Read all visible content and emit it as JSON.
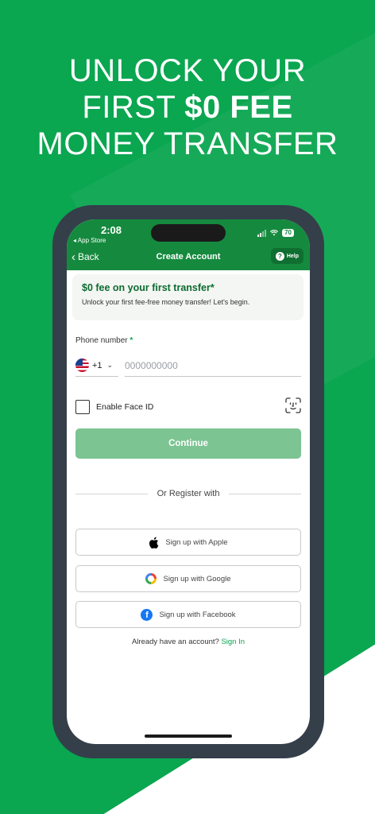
{
  "headline": {
    "line1": "UNLOCK YOUR",
    "line2_prefix": "FIRST ",
    "line2_bold": "$0 FEE",
    "line3": "MONEY TRANSFER"
  },
  "status_bar": {
    "time": "2:08",
    "back_app": "◂ App Store",
    "battery": "70"
  },
  "nav": {
    "back_label": "Back",
    "title": "Create Account",
    "help_label": "Help"
  },
  "promo": {
    "title": "$0 fee on your first transfer*",
    "subtitle": "Unlock your first fee-free money transfer! Let's begin."
  },
  "phone_field": {
    "label": "Phone number",
    "required_mark": "*",
    "country_code": "+1",
    "placeholder": "0000000000",
    "value": ""
  },
  "face_id": {
    "label": "Enable Face ID",
    "checked": false
  },
  "continue_label": "Continue",
  "divider_text": "Or Register with",
  "social": {
    "apple": "Sign up with Apple",
    "google": "Sign up with Google",
    "facebook": "Sign up with Facebook"
  },
  "signin": {
    "prompt": "Already have an account?",
    "link": "Sign In"
  },
  "colors": {
    "background": "#0aa650",
    "header": "#158a3e",
    "accent": "#0aa650",
    "continue_disabled": "#7cc492"
  }
}
